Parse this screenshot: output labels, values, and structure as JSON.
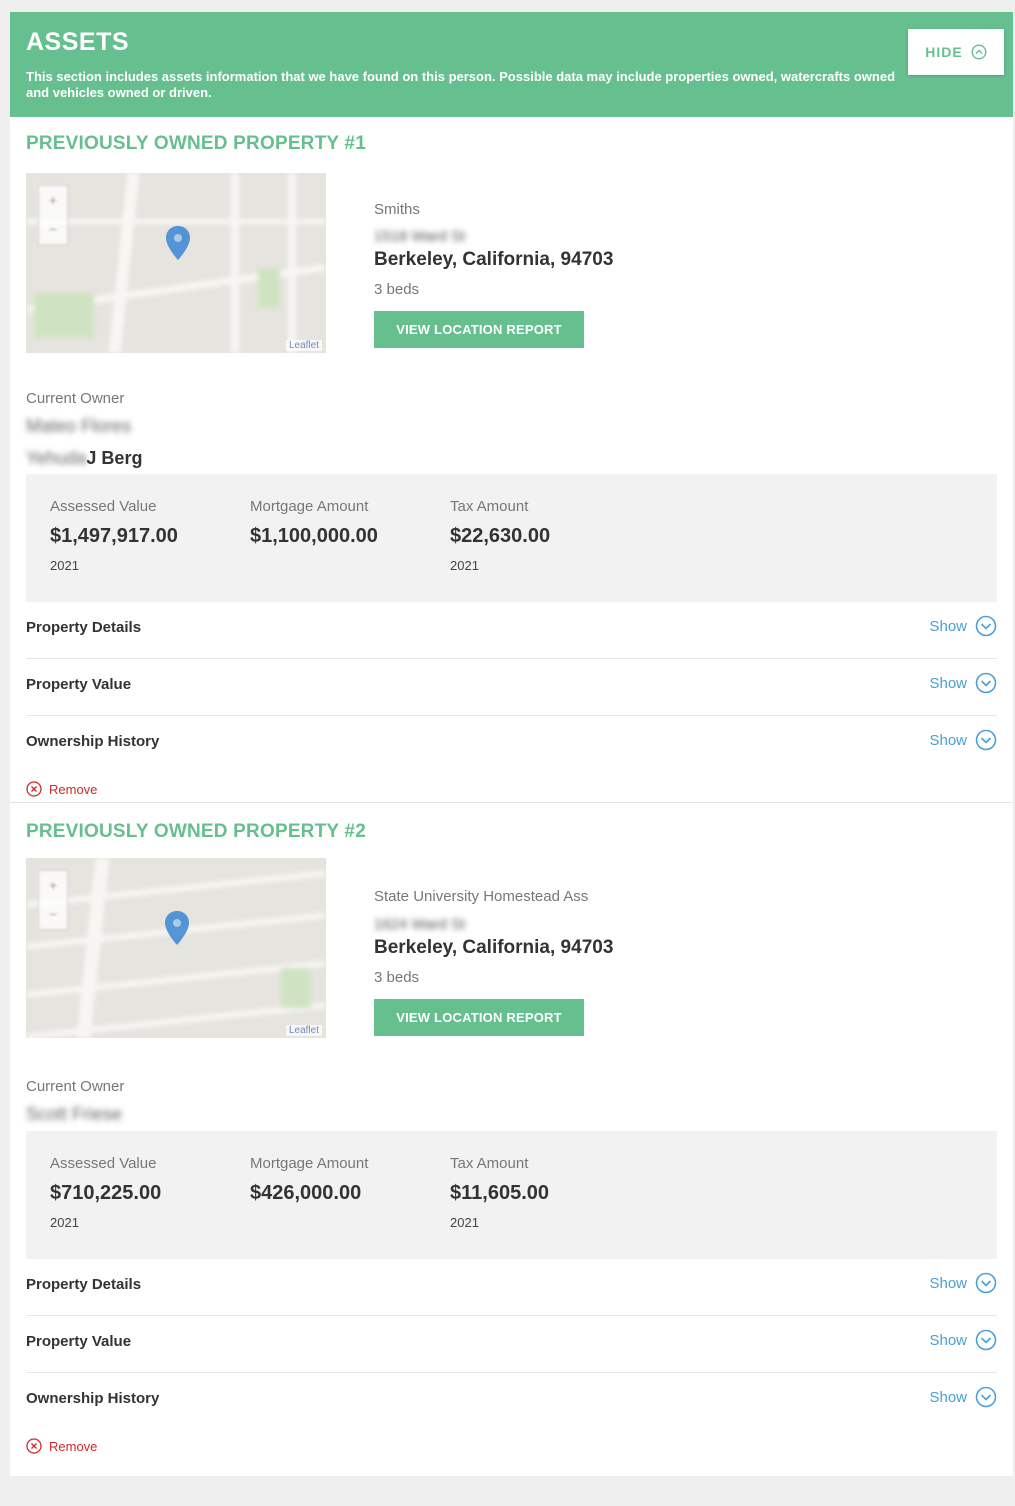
{
  "section": {
    "title": "ASSETS",
    "description": "This section includes assets information that we have found on this person. Possible data may include properties owned, watercrafts owned and vehicles owned or driven.",
    "hide_label": "HIDE"
  },
  "properties": [
    {
      "title": "PREVIOUSLY OWNED PROPERTY #1",
      "owner_company": "Smiths",
      "street_redacted": "1518 Ward St",
      "city_line": "Berkeley, California, 94703",
      "beds": "3 beds",
      "view_button": "VIEW LOCATION REPORT",
      "map_attribution": "Leaflet",
      "current_owner_label": "Current Owner",
      "owners": [
        {
          "redacted": "Mateo Flores",
          "visible": ""
        },
        {
          "redacted": "Yehuda",
          "visible": "J Berg"
        }
      ],
      "values": [
        {
          "label": "Assessed Value",
          "amount": "$1,497,917.00",
          "year": "2021"
        },
        {
          "label": "Mortgage Amount",
          "amount": "$1,100,000.00",
          "year": ""
        },
        {
          "label": "Tax Amount",
          "amount": "$22,630.00",
          "year": "2021"
        }
      ],
      "sections": [
        {
          "label": "Property Details",
          "action": "Show"
        },
        {
          "label": "Property Value",
          "action": "Show"
        },
        {
          "label": "Ownership History",
          "action": "Show"
        }
      ],
      "remove_label": "Remove"
    },
    {
      "title": "PREVIOUSLY OWNED PROPERTY #2",
      "owner_company": "State University Homestead Ass",
      "street_redacted": "1624 Ward St",
      "city_line": "Berkeley, California, 94703",
      "beds": "3 beds",
      "view_button": "VIEW LOCATION REPORT",
      "map_attribution": "Leaflet",
      "current_owner_label": "Current Owner",
      "owners": [
        {
          "redacted": "Scott Friese",
          "visible": ""
        }
      ],
      "values": [
        {
          "label": "Assessed Value",
          "amount": "$710,225.00",
          "year": "2021"
        },
        {
          "label": "Mortgage Amount",
          "amount": "$426,000.00",
          "year": ""
        },
        {
          "label": "Tax Amount",
          "amount": "$11,605.00",
          "year": "2021"
        }
      ],
      "sections": [
        {
          "label": "Property Details",
          "action": "Show"
        },
        {
          "label": "Property Value",
          "action": "Show"
        },
        {
          "label": "Ownership History",
          "action": "Show"
        }
      ],
      "remove_label": "Remove"
    }
  ],
  "colors": {
    "accent": "#66bf8f",
    "link": "#4a9fd6",
    "danger": "#cc2a2a",
    "box": "#f2f2f2"
  },
  "icons": {
    "hide": "chevron-up-circle-icon",
    "show": "chevron-down-circle-icon",
    "remove": "x-circle-icon",
    "map_pin": "map-pin-icon"
  }
}
